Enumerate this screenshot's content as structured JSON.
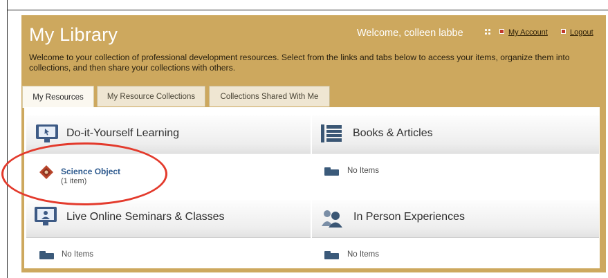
{
  "header": {
    "title": "My Library",
    "welcome_text": "Welcome, colleen labbe",
    "my_account_label": "My Account",
    "logout_label": "Logout",
    "intro": "Welcome to your collection of professional development resources. Select from the links and tabs below to access your items, organize them into collections, and then share your collections with others."
  },
  "tabs": [
    {
      "label": "My Resources",
      "active": true
    },
    {
      "label": "My Resource Collections",
      "active": false
    },
    {
      "label": "Collections Shared With Me",
      "active": false
    }
  ],
  "categories": [
    {
      "title": "Do-it-Yourself Learning",
      "icon": "monitor-icon",
      "item_name": "Science Object",
      "item_count": "(1 item)"
    },
    {
      "title": "Books & Articles",
      "icon": "books-icon",
      "empty_text": "No Items"
    },
    {
      "title": "Live Online Seminars & Classes",
      "icon": "presentation-icon",
      "empty_text": "No Items"
    },
    {
      "title": "In Person Experiences",
      "icon": "people-icon",
      "empty_text": "No Items"
    }
  ],
  "colors": {
    "header_bg": "#cda85e",
    "link_blue": "#2f5b8f",
    "annotation_red": "#e33a2c"
  }
}
